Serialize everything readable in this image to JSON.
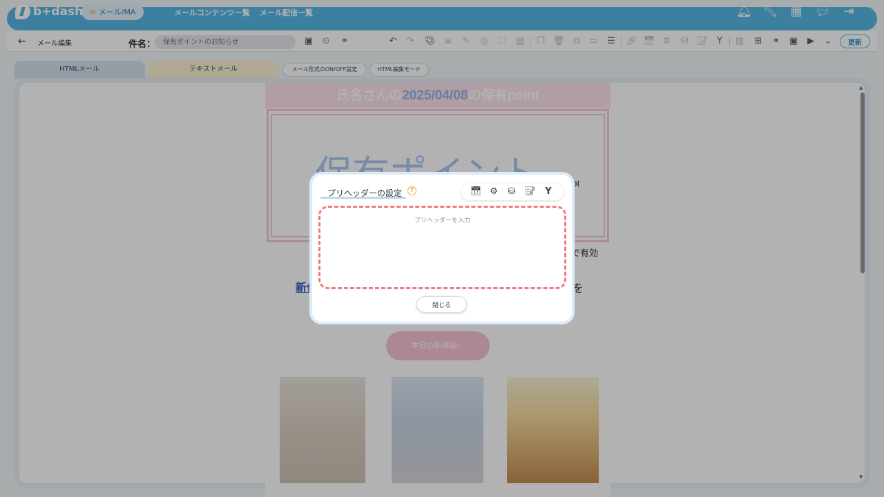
{
  "topnav": {
    "logo_text": "b+dash",
    "mode_label": "メール/MA",
    "links": [
      "メールコンテンツ一覧",
      "メール配信一覧"
    ],
    "icons": [
      "bell-icon",
      "wrench-icon",
      "grid-icon",
      "chat-icon",
      "logout-icon"
    ]
  },
  "toolbar": {
    "back_label": "←",
    "title": "メール編集",
    "subject_label": "件名：",
    "subject_placeholder": "保有ポイントのお知らせ",
    "update_label": "更新"
  },
  "tabs": {
    "html_mail": "HTMLメール",
    "text_mail": "テキストメール",
    "format_toggle": "メール形式のON/OFF設定",
    "html_mode": "HTML編集モード"
  },
  "email_preview": {
    "header_name": "氏名さんの",
    "header_date": "2025/04/08",
    "header_tail": "の保有point",
    "big_text": "保有ポイント",
    "pt_suffix": "pt",
    "valid_text": "まで有効",
    "new_link": "新作",
    "tail_char": "を",
    "new_items_button": "本日の新商品！"
  },
  "modal": {
    "title": "プリヘッダーの設定",
    "help": "?",
    "textarea_placeholder": "プリヘッダーを入力",
    "textarea_value": "",
    "close_label": "閉じる",
    "tool_icons": [
      "calendar-icon",
      "gears-icon",
      "database-icon",
      "add-note-icon",
      "branch-icon"
    ]
  },
  "colors": {
    "nav_blue": "#57b6e4",
    "accent_blue": "#3796d6",
    "dashed_red": "#f07a7f",
    "header_pink": "#fde3e8"
  }
}
